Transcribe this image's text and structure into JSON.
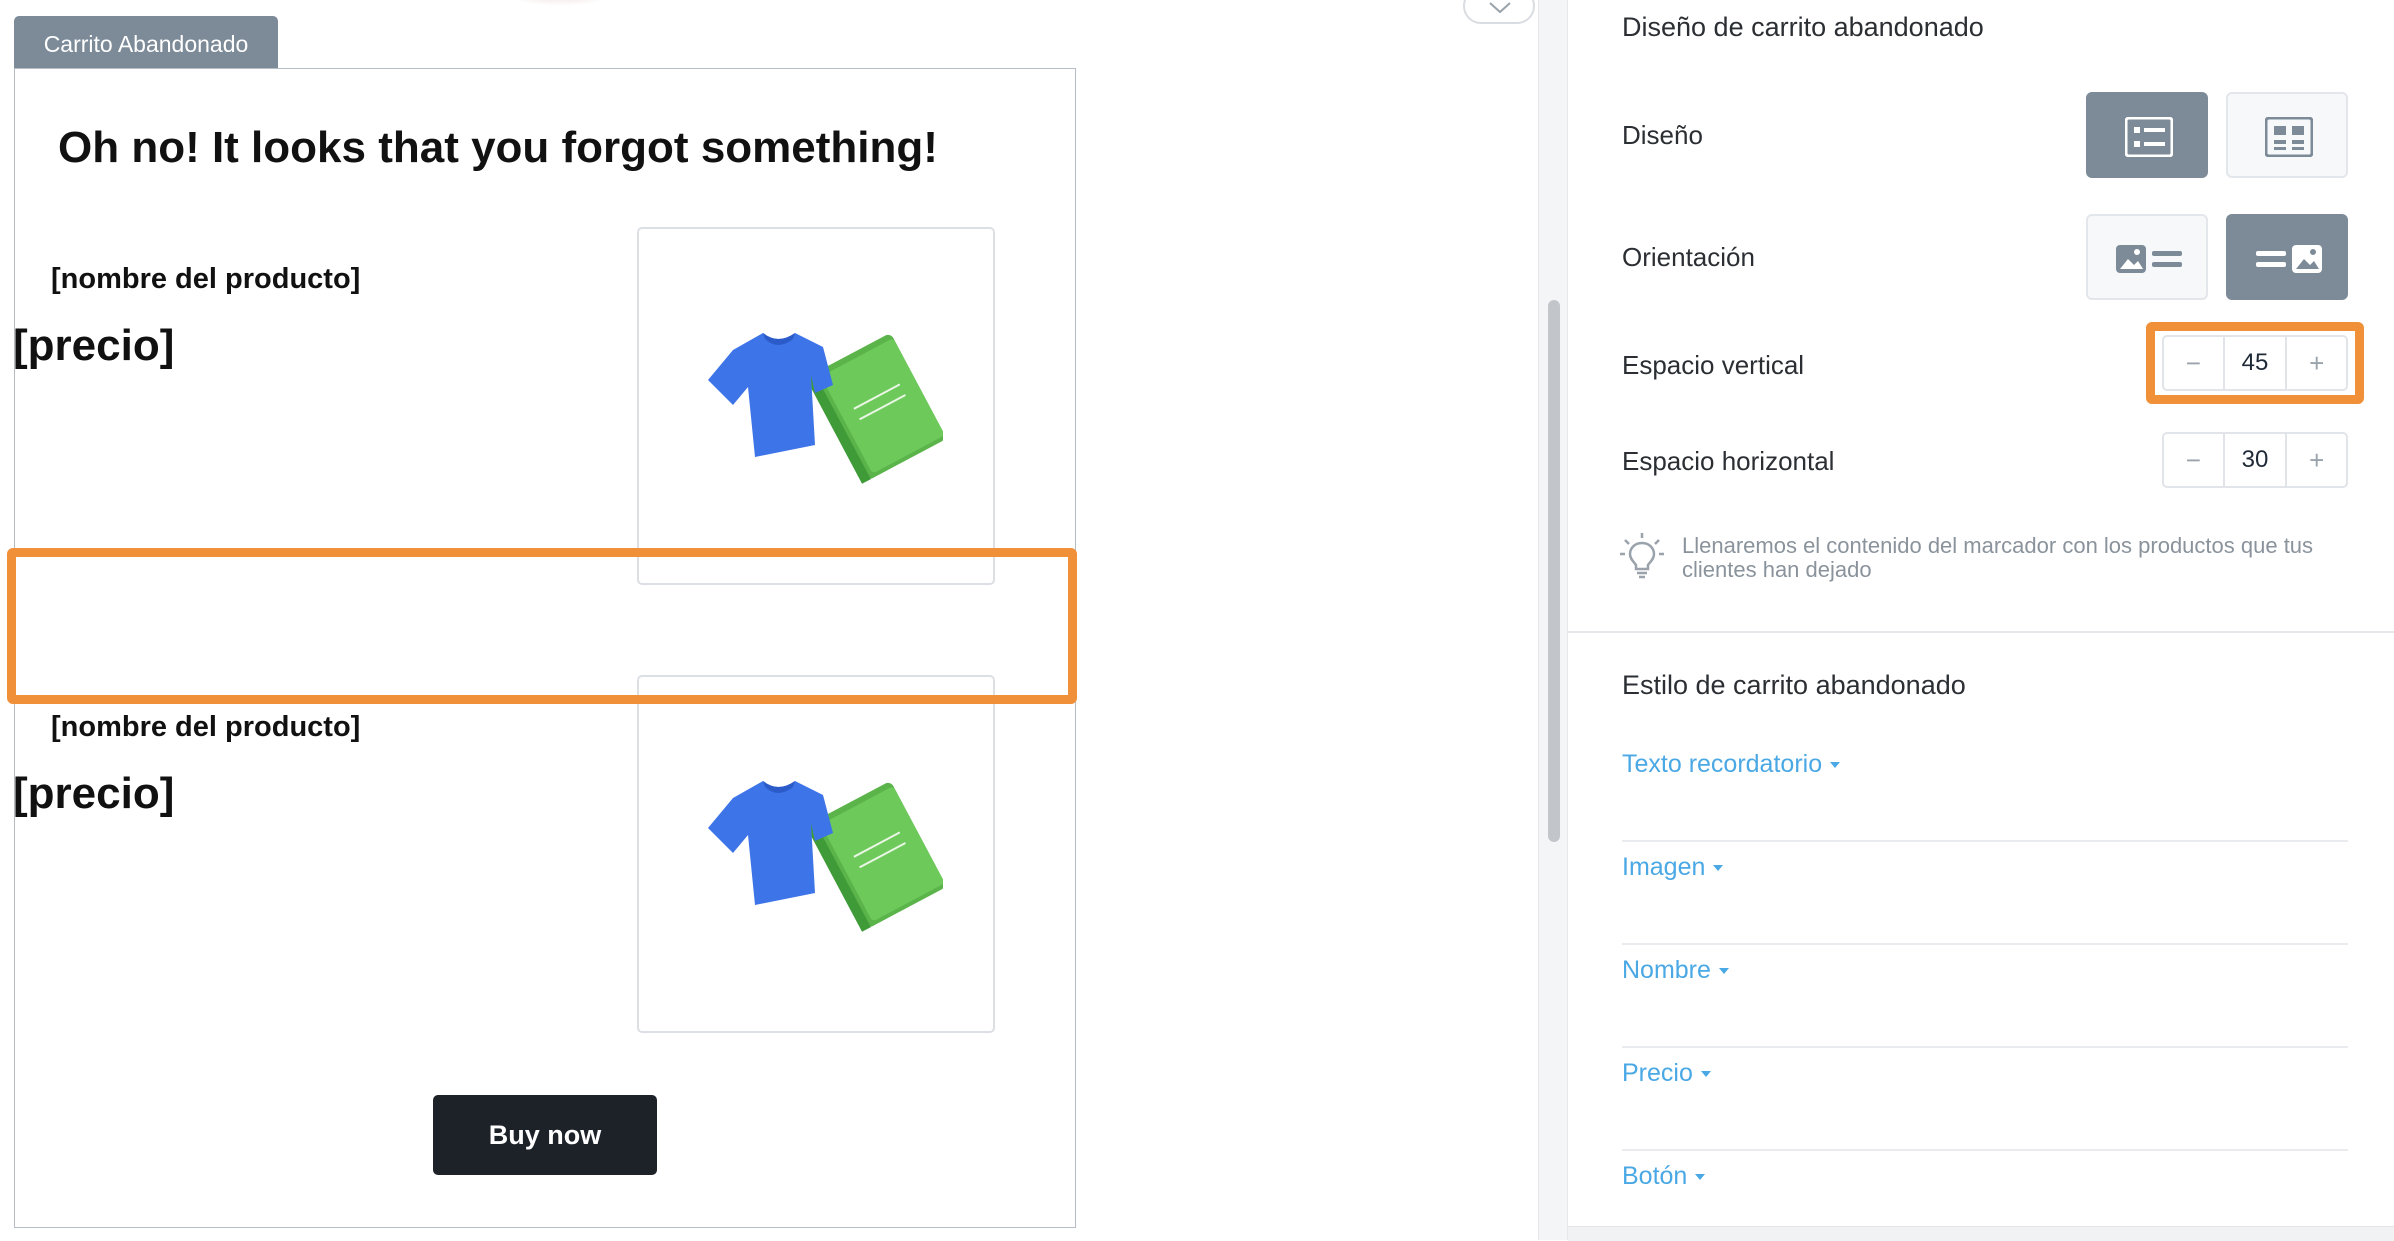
{
  "preview": {
    "block_tag": "Carrito Abandonado",
    "email": {
      "heading": "Oh no! It looks that you forgot something!",
      "products": [
        {
          "name": "[nombre del producto]",
          "price": "[precio]",
          "image_icon": "product-placeholder-icon"
        },
        {
          "name": "[nombre del producto]",
          "price": "[precio]",
          "image_icon": "product-placeholder-icon"
        }
      ],
      "button_label": "Buy now"
    }
  },
  "panel": {
    "design_section": {
      "title": "Diseño de carrito abandonado",
      "layout_label": "Diseño",
      "layout_options": [
        {
          "icon": "list-layout-icon",
          "selected": true
        },
        {
          "icon": "grid-layout-icon",
          "selected": false
        }
      ],
      "orientation_label": "Orientación",
      "orientation_options": [
        {
          "icon": "image-left-icon",
          "selected": false
        },
        {
          "icon": "image-right-icon",
          "selected": true
        }
      ],
      "vertical_spacing": {
        "label": "Espacio vertical",
        "value": "45",
        "minus": "−",
        "plus": "+"
      },
      "horizontal_spacing": {
        "label": "Espacio horizontal",
        "value": "30",
        "minus": "−",
        "plus": "+"
      },
      "tip": {
        "icon": "lightbulb-icon",
        "text": "Llenaremos el contenido del marcador con los productos que tus clientes han dejado"
      }
    },
    "style_section": {
      "title": "Estilo de carrito abandonado",
      "items": [
        "Texto recordatorio",
        "Imagen",
        "Nombre",
        "Precio",
        "Botón"
      ]
    }
  },
  "colors": {
    "highlight": "#f0913a",
    "active_option": "#7d8b99",
    "link": "#4aa8e4",
    "button": "#1d2229"
  }
}
